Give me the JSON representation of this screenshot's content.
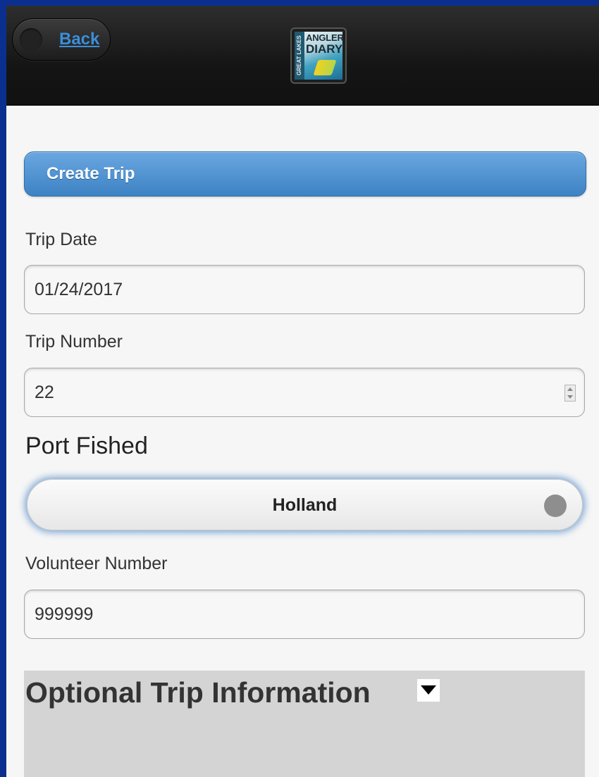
{
  "header": {
    "back_label": "Back",
    "logo": {
      "line1": "ANGLER",
      "line2": "DIARY",
      "side": "GREAT LAKES"
    }
  },
  "section": {
    "title": "Create Trip"
  },
  "form": {
    "trip_date_label": "Trip Date",
    "trip_date_value": "01/24/2017",
    "trip_number_label": "Trip Number",
    "trip_number_value": "22",
    "port_label": "Port Fished",
    "port_value": "Holland",
    "volunteer_label": "Volunteer Number",
    "volunteer_value": "999999"
  },
  "optional": {
    "title": "Optional Trip Information",
    "toggle_icon": "caret-down-icon"
  },
  "colors": {
    "frame": "#0a2f8f",
    "header": "#151515",
    "accent": "#3d82c4",
    "link": "#3b8fd9"
  }
}
